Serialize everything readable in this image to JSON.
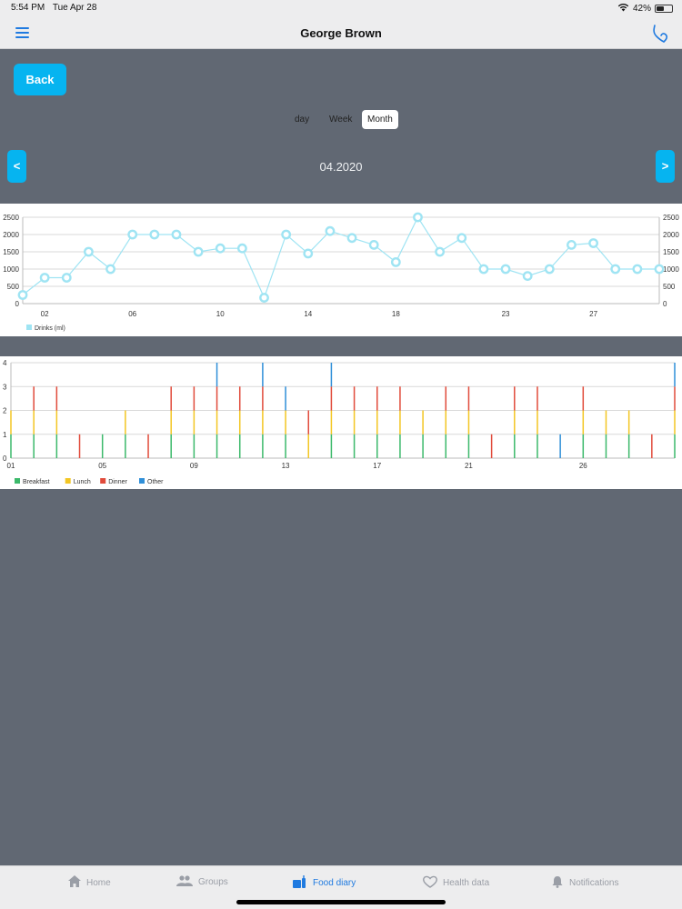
{
  "status_bar": {
    "time": "5:54 PM",
    "date": "Tue Apr 28",
    "battery": "42%",
    "battery_level": 0.42
  },
  "header": {
    "title": "George Brown"
  },
  "back_label": "Back",
  "period_tabs": [
    {
      "label": "day",
      "active": false
    },
    {
      "label": "Week",
      "active": false
    },
    {
      "label": "Month",
      "active": true
    }
  ],
  "date_nav": {
    "prev": "<",
    "next": ">",
    "label": "04.2020"
  },
  "colors": {
    "accent": "#06b4f0",
    "drinks": "#9fe4f3",
    "breakfast": "#3cb96b",
    "lunch": "#f3c623",
    "dinner": "#e14b3b",
    "other": "#2f8fd8"
  },
  "chart_data": [
    {
      "type": "line",
      "x_ticks": [
        "02",
        "06",
        "10",
        "14",
        "18",
        "23",
        "27"
      ],
      "x": [
        1,
        2,
        3,
        4,
        5,
        6,
        7,
        8,
        9,
        10,
        11,
        12,
        13,
        14,
        15,
        16,
        17,
        18,
        19,
        20,
        21,
        22,
        23,
        24,
        25,
        26,
        27,
        28,
        29,
        30
      ],
      "series": [
        {
          "name": "Drinks (ml)",
          "values": [
            250,
            750,
            750,
            1500,
            1000,
            2000,
            2000,
            2000,
            1500,
            1600,
            1600,
            170,
            2000,
            1450,
            2100,
            1900,
            1700,
            1200,
            2500,
            1500,
            1900,
            1000,
            1000,
            800,
            1000,
            1700,
            1750,
            1000,
            1000,
            1000
          ]
        }
      ],
      "y_ticks": [
        "0",
        "500",
        "1000",
        "1500",
        "2000",
        "2500"
      ],
      "ylim": [
        0,
        2500
      ],
      "grid": true,
      "legend": "bottom-left"
    },
    {
      "type": "bar",
      "x_ticks": [
        "01",
        "05",
        "09",
        "13",
        "17",
        "21",
        "26"
      ],
      "y_ticks": [
        "0",
        "1",
        "2",
        "3",
        "4"
      ],
      "ylim": [
        0,
        4
      ],
      "grid": true,
      "legend": "bottom-left",
      "series": [
        {
          "name": "Breakfast",
          "values": [
            1,
            1,
            1,
            0,
            1,
            1,
            0,
            1,
            1,
            1,
            1,
            1,
            1,
            0,
            1,
            1,
            1,
            1,
            1,
            1,
            1,
            0,
            1,
            1,
            0,
            1,
            1,
            1,
            0,
            1
          ]
        },
        {
          "name": "Lunch",
          "values": [
            1,
            1,
            1,
            0,
            0,
            1,
            0,
            1,
            1,
            1,
            1,
            1,
            1,
            1,
            1,
            1,
            1,
            1,
            1,
            1,
            1,
            0,
            1,
            1,
            0,
            1,
            1,
            1,
            0,
            1
          ]
        },
        {
          "name": "Dinner",
          "values": [
            0,
            1,
            1,
            1,
            0,
            0,
            1,
            1,
            1,
            1,
            1,
            1,
            0,
            1,
            1,
            1,
            1,
            1,
            0,
            1,
            1,
            1,
            1,
            1,
            0,
            1,
            0,
            0,
            1,
            1
          ]
        },
        {
          "name": "Other",
          "values": [
            0,
            0,
            0,
            0,
            0,
            0,
            0,
            0,
            0,
            1,
            0,
            1,
            1,
            0,
            1,
            0,
            0,
            0,
            0,
            0,
            0,
            0,
            0,
            0,
            1,
            0,
            0,
            0,
            0,
            1
          ]
        }
      ]
    }
  ],
  "tabs": [
    {
      "label": "Home",
      "active": false
    },
    {
      "label": "Groups",
      "active": false
    },
    {
      "label": "Food diary",
      "active": true
    },
    {
      "label": "Health data",
      "active": false
    },
    {
      "label": "Notifications",
      "active": false
    }
  ]
}
